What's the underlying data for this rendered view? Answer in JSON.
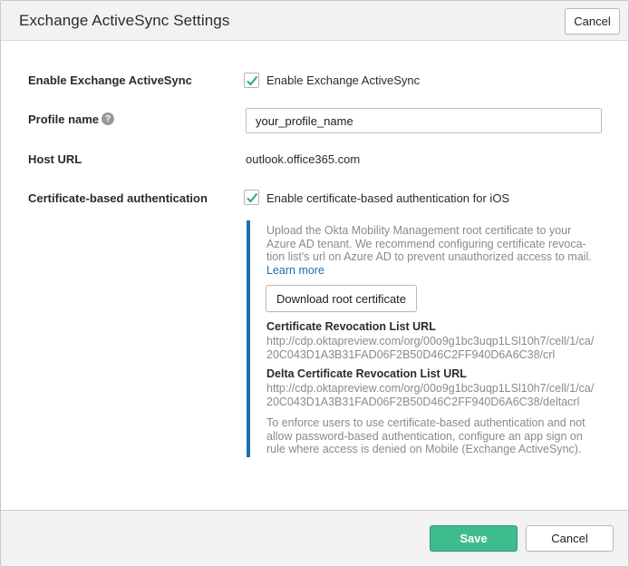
{
  "header": {
    "title": "Exchange ActiveSync Settings",
    "cancel_label": "Cancel"
  },
  "form": {
    "enable_eas": {
      "label": "Enable Exchange ActiveSync",
      "checkbox_label": "Enable Exchange ActiveSync",
      "checked": true
    },
    "profile_name": {
      "label": "Profile name",
      "help_glyph": "?",
      "value": "your_profile_name"
    },
    "host_url": {
      "label": "Host URL",
      "value": "outlook.office365.com"
    },
    "cert_auth": {
      "label": "Certificate-based authentication",
      "checkbox_label": "Enable certificate-based authentication for iOS",
      "checked": true
    }
  },
  "info": {
    "intro_lines": [
      "Upload the Okta Mobility Management root certificate to your",
      "Azure AD tenant. We recommend configuring certificate revoca-",
      "tion list's url on Azure AD to prevent unauthorized access to mail."
    ],
    "learn_more": "Learn more",
    "download_label": "Download root certificate",
    "crl_title": "Certificate Revocation List URL",
    "crl_lines": [
      "http://cdp.oktapreview.com/org/00o9g1bc3uqp1LSl10h7/cell/1/ca/",
      "20C043D1A3B31FAD06F2B50D46C2FF940D6A6C38/crl"
    ],
    "delta_title": "Delta Certificate Revocation List URL",
    "delta_lines": [
      "http://cdp.oktapreview.com/org/00o9g1bc3uqp1LSl10h7/cell/1/ca/",
      "20C043D1A3B31FAD06F2B50D46C2FF940D6A6C38/deltacrl"
    ],
    "enforce_lines": [
      "To enforce users to use certificate-based authentication and not",
      "allow password-based authentication, configure an app sign on",
      "rule where access is denied on Mobile (Exchange ActiveSync)."
    ]
  },
  "footer": {
    "save_label": "Save",
    "cancel_label": "Cancel"
  },
  "colors": {
    "accent_blue": "#1a6fb2",
    "save_green": "#3fbc8e",
    "check_teal": "#2aa77e"
  }
}
